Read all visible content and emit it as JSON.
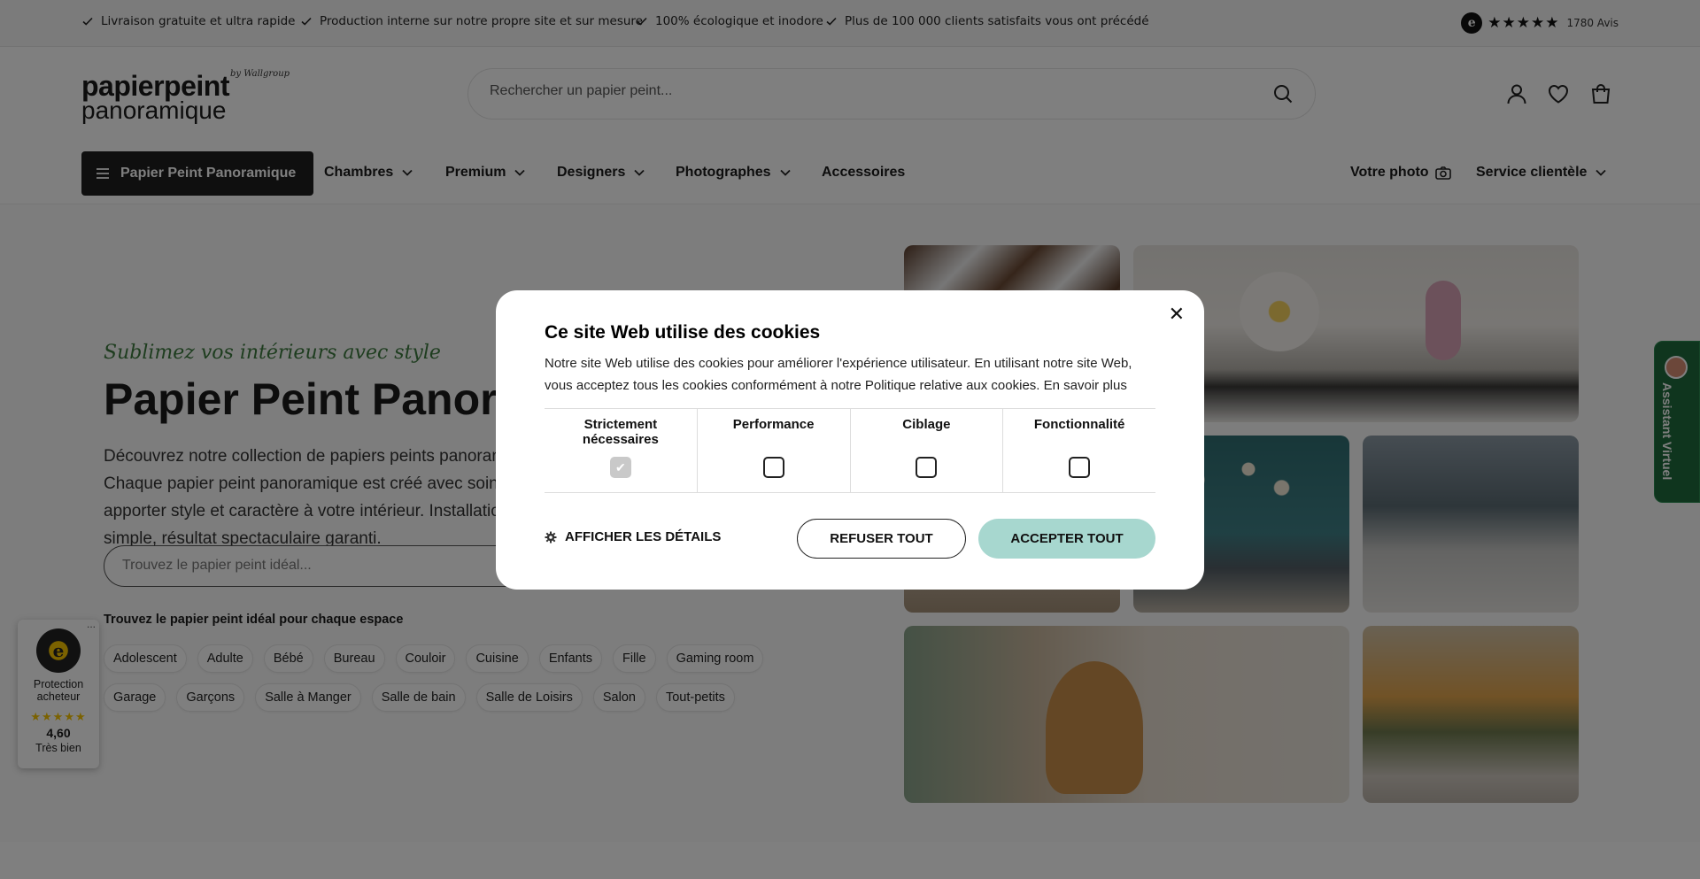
{
  "topbar": {
    "usps": [
      "Livraison gratuite et ultra rapide",
      "Production interne sur notre propre site et sur mesure",
      "100% écologique et inodore",
      "Plus de 100 000 clients satisfaits vous ont précédé"
    ],
    "rating": {
      "stars": "★★★★★",
      "reviews": "1780 Avis"
    }
  },
  "header": {
    "logo": {
      "line1": "papierpeint",
      "line2": "panoramique",
      "by": "by Wallgroup"
    },
    "search_placeholder": "Rechercher un papier peint...",
    "icons": [
      "user-icon",
      "heart-icon",
      "cart-icon"
    ]
  },
  "nav": {
    "main": "Papier Peint Panoramique",
    "items": [
      "Chambres",
      "Premium",
      "Designers",
      "Photographes",
      "Accessoires"
    ],
    "right": [
      "Votre photo",
      "Service clientèle"
    ]
  },
  "hero": {
    "tagline": "Sublimez vos intérieurs avec style",
    "title": "Papier Peint Panoramique",
    "description": "Découvrez notre collection de papiers peints panoramiques. Chaque papier peint panoramique est créé avec soin pour apporter style et caractère à votre intérieur. Installation simple, résultat spectaculaire garanti.",
    "search_placeholder": "Trouvez le papier peint idéal...",
    "categories_title": "Trouvez le papier peint idéal pour chaque espace",
    "categories_row1": [
      "Adolescent",
      "Adulte",
      "Bébé",
      "Bureau",
      "Couloir",
      "Cuisine",
      "Enfants",
      "Fille",
      "Gaming room"
    ],
    "categories_row2": [
      "Garage",
      "Garçons",
      "Salle à Manger",
      "Salle de bain",
      "Salle de Loisirs",
      "Salon",
      "Tout-petits"
    ]
  },
  "trust_badge": {
    "label": "Protection acheteur",
    "stars": "★★★★★",
    "score": "4,60",
    "verdict": "Très bien",
    "seal": "e",
    "more": "..."
  },
  "side_tab": {
    "label": "Assistant Virtuel"
  },
  "cookie_modal": {
    "title": "Ce site Web utilise des cookies",
    "text": "Notre site Web utilise des cookies pour améliorer l'expérience utilisateur. En utilisant notre site Web, vous acceptez tous les cookies conformément à notre Politique relative aux cookies. En savoir plus",
    "categories": [
      {
        "label": "Strictement nécessaires",
        "checked": true
      },
      {
        "label": "Performance",
        "checked": false
      },
      {
        "label": "Ciblage",
        "checked": false
      },
      {
        "label": "Fonctionnalité",
        "checked": false
      }
    ],
    "details_label": "AFFICHER LES DÉTAILS",
    "refuse_label": "REFUSER TOUT",
    "accept_label": "ACCEPTER TOUT",
    "close": "✕"
  }
}
